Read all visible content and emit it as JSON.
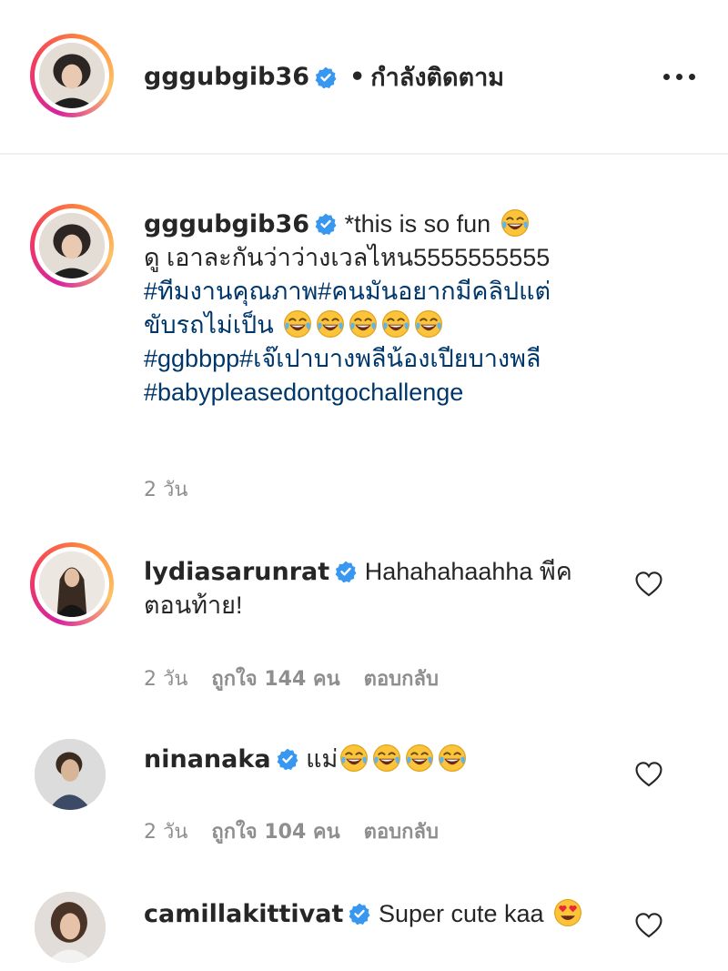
{
  "header": {
    "username": "gggubgib36",
    "separator": "•",
    "follow_state": "กำลังติดตาม"
  },
  "caption": {
    "username": "gggubgib36",
    "text_1": "*this is so fun",
    "text_2": "ดู เอาละกันว่าว่างเวลไหน5555555555",
    "tag_1": "#ทีมงานคุณภาพ",
    "tag_2": "#คนมันอยากมีคลิปแต่ขับรถไม่เป็น",
    "tag_3": "#ggbbpp",
    "tag_4": "#เจ๊เปาบางพลีน้องเปียบางพลี",
    "tag_5": "#babypleasedontgochallenge",
    "time": "2 วัน",
    "emoji_names": [
      "face-with-tears-of-joy"
    ]
  },
  "comments": [
    {
      "username": "lydiasarunrat",
      "text": "Hahahahaahha พีคตอนท้าย!",
      "time": "2 วัน",
      "likes": "ถูกใจ 144 คน",
      "reply": "ตอบกลับ"
    },
    {
      "username": "ninanaka",
      "text": "แม่",
      "emoji_count": 4,
      "time": "2 วัน",
      "likes": "ถูกใจ 104 คน",
      "reply": "ตอบกลับ"
    },
    {
      "username": "camillakittivat",
      "text": "Super cute kaa",
      "emoji": "smiling-face-with-heart-eyes"
    }
  ],
  "colors": {
    "text": "#262626",
    "hashtag": "#00376b",
    "muted": "#8e8e8e",
    "verified": "#3897f0",
    "divider": "#efefef"
  }
}
